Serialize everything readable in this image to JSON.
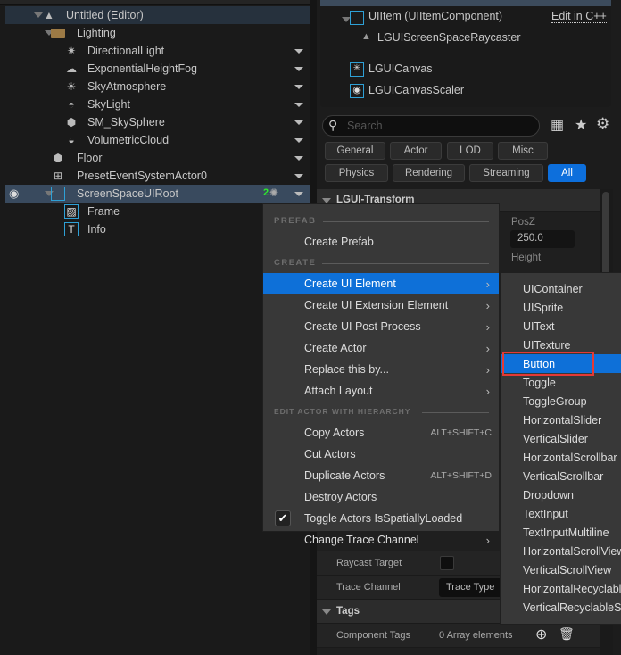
{
  "outliner": {
    "rows": [
      {
        "label": "Untitled (Editor)",
        "icon": "level-icon"
      },
      {
        "label": "Lighting",
        "icon": "folder-icon"
      },
      {
        "label": "DirectionalLight",
        "icon": "directional-light-icon"
      },
      {
        "label": "ExponentialHeightFog",
        "icon": "fog-icon"
      },
      {
        "label": "SkyAtmosphere",
        "icon": "sky-atmosphere-icon"
      },
      {
        "label": "SkyLight",
        "icon": "sky-light-icon"
      },
      {
        "label": "SM_SkySphere",
        "icon": "static-mesh-icon"
      },
      {
        "label": "VolumetricCloud",
        "icon": "cloud-icon"
      },
      {
        "label": "Floor",
        "icon": "static-mesh-icon"
      },
      {
        "label": "PresetEventSystemActor0",
        "icon": "event-system-icon"
      },
      {
        "label": "ScreenSpaceUIRoot",
        "icon": "ui-item-icon",
        "badge": "2"
      },
      {
        "label": "Frame",
        "icon": "ui-texture-icon"
      },
      {
        "label": "Info",
        "icon": "ui-text-icon"
      }
    ]
  },
  "components": {
    "items": [
      {
        "label": "UIItem (UIItemComponent)",
        "link": "Edit in C++"
      },
      {
        "label": "LGUIScreenSpaceRaycaster"
      },
      {
        "label": "LGUICanvas"
      },
      {
        "label": "LGUICanvasScaler"
      }
    ]
  },
  "details": {
    "search_placeholder": "Search",
    "filters": [
      "General",
      "Actor",
      "LOD",
      "Misc",
      "Physics",
      "Rendering",
      "Streaming",
      "All"
    ],
    "active_filter": "All",
    "section_transform": "LGUI-Transform",
    "posz_label": "PosZ",
    "posz_value": "250.0",
    "height_label": "Height",
    "raycast_target": "Raycast Target",
    "trace_channel": "Trace Channel",
    "trace_channel_value": "Trace Type",
    "tags_section": "Tags",
    "component_tags": "Component Tags",
    "component_tags_value": "0 Array elements"
  },
  "context_menu": {
    "section_prefab": "PREFAB",
    "create_prefab": "Create Prefab",
    "section_create": "CREATE",
    "create_items": [
      "Create UI Element",
      "Create UI Extension Element",
      "Create UI Post Process",
      "Create Actor",
      "Replace this by...",
      "Attach Layout"
    ],
    "section_edit": "EDIT ACTOR WITH HIERARCHY",
    "edit_items": [
      {
        "label": "Copy Actors",
        "shortcut": "ALT+SHIFT+C"
      },
      {
        "label": "Cut Actors"
      },
      {
        "label": "Duplicate Actors",
        "shortcut": "ALT+SHIFT+D"
      },
      {
        "label": "Destroy Actors"
      },
      {
        "label": "Toggle Actors IsSpatiallyLoaded",
        "checked": true
      },
      {
        "label": "Change Trace Channel"
      }
    ]
  },
  "submenu": {
    "items": [
      "UIContainer",
      "UISprite",
      "UIText",
      "UITexture",
      "Button",
      "Toggle",
      "ToggleGroup",
      "HorizontalSlider",
      "VerticalSlider",
      "HorizontalScrollbar",
      "VerticalScrollbar",
      "Dropdown",
      "TextInput",
      "TextInputMultiline",
      "HorizontalScrollView",
      "VerticalScrollView",
      "HorizontalRecyclableScrollView",
      "VerticalRecyclableScrollView"
    ],
    "highlighted": "Button",
    "highlight_color": "#e53935"
  },
  "colors": {
    "accent": "#0e70d8",
    "ui_icon": "#2ea0d6"
  }
}
